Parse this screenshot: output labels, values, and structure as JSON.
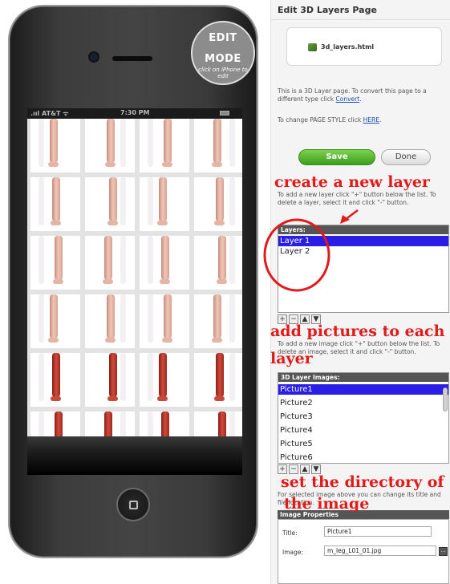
{
  "phone": {
    "badge_line1": "EDIT",
    "badge_line2": "MODE",
    "badge_hint": "click on iPhone to edit",
    "carrier": ".ııl AT&T ᯤ",
    "time": "7:30 PM",
    "battery_icon": "battery-icon",
    "home_icon": "home-button-icon"
  },
  "panel": {
    "title": "Edit 3D Layers Page",
    "file_name": "3d_layers.html",
    "file_icon": "html-file-icon",
    "convert_text": "This is a 3D Layer page. To convert this page to a different type click",
    "convert_link": "Convert",
    "style_text": "To change PAGE STYLE click",
    "style_link": "HERE",
    "save_label": "Save",
    "done_label": "Done",
    "layers_help": "To add a new layer click \"+\" button below the list. To delete a layer, select it and click \"-\" button.",
    "layers_header": "Layers:",
    "layers": [
      "Layer 1",
      "Layer 2"
    ],
    "images_help": "To add a new image click \"+\" button below the list. To delete an image, select it and click \"-\" button.",
    "images_header": "3D Layer Images:",
    "images": [
      "Picture1",
      "Picture2",
      "Picture3",
      "Picture4",
      "Picture5",
      "Picture6"
    ],
    "props_help": "For selected image above you can change its title and file location.",
    "props_header": "Image Properties",
    "title_label": "Title:",
    "title_value": "Picture1",
    "image_label": "Image:",
    "image_value": "m_leg_L01_01.jpg",
    "browse_label": "...",
    "tool_buttons": [
      "+",
      "−",
      "▲",
      "▼"
    ]
  },
  "annotations": {
    "create_layer": "create a new layer",
    "add_pictures_1": "add pictures to each",
    "add_pictures_2": "layer",
    "directory_1": "set the directory of",
    "directory_2": "the image"
  },
  "colors": {
    "annotation_red": "#e21a1a",
    "selection_blue": "#2a1ee6",
    "save_green": "#3b9e1e"
  }
}
